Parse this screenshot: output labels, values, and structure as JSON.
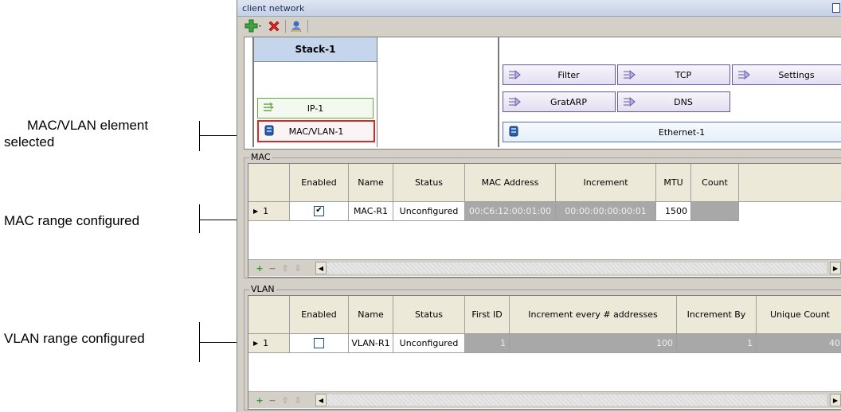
{
  "annotations": {
    "mac_vlan_selected_line1": "MAC/VLAN element",
    "mac_vlan_selected_line2": "selected",
    "mac_range": "MAC range configured",
    "vlan_range": "VLAN range configured"
  },
  "window": {
    "title": "client network"
  },
  "stack": {
    "header": "Stack-1",
    "elements": [
      {
        "label": "IP-1",
        "icon": "ip-icon",
        "selected": false
      },
      {
        "label": "MAC/VLAN-1",
        "icon": "mac-vlan-icon",
        "selected": true
      }
    ]
  },
  "protocols": {
    "row1": [
      "Filter",
      "TCP",
      "Settings"
    ],
    "row2": [
      "GratARP",
      "DNS"
    ],
    "ethernet": "Ethernet-1"
  },
  "mac": {
    "legend": "MAC",
    "columns": [
      "Enabled",
      "Name",
      "Status",
      "MAC Address",
      "Increment",
      "MTU",
      "Count"
    ],
    "rows": [
      {
        "index": "1",
        "enabled": true,
        "name": "MAC-R1",
        "status": "Unconfigured",
        "mac_address": "00:C6:12:00:01:00",
        "increment": "00:00:00:00:00:01",
        "mtu": "1500",
        "count": ""
      }
    ]
  },
  "vlan": {
    "legend": "VLAN",
    "columns": [
      "Enabled",
      "Name",
      "Status",
      "First ID",
      "Increment every # addresses",
      "Increment By",
      "Unique Count"
    ],
    "rows": [
      {
        "index": "1",
        "enabled": false,
        "name": "VLAN-R1",
        "status": "Unconfigured",
        "first_id": "1",
        "increment_every": "100",
        "increment_by": "1",
        "unique_count": "40"
      }
    ]
  },
  "colors": {
    "selected_border": "#d22b2b",
    "element_border": "#68a648",
    "protocol_border": "#6257a8",
    "header_blue": "#c5d5ec"
  }
}
